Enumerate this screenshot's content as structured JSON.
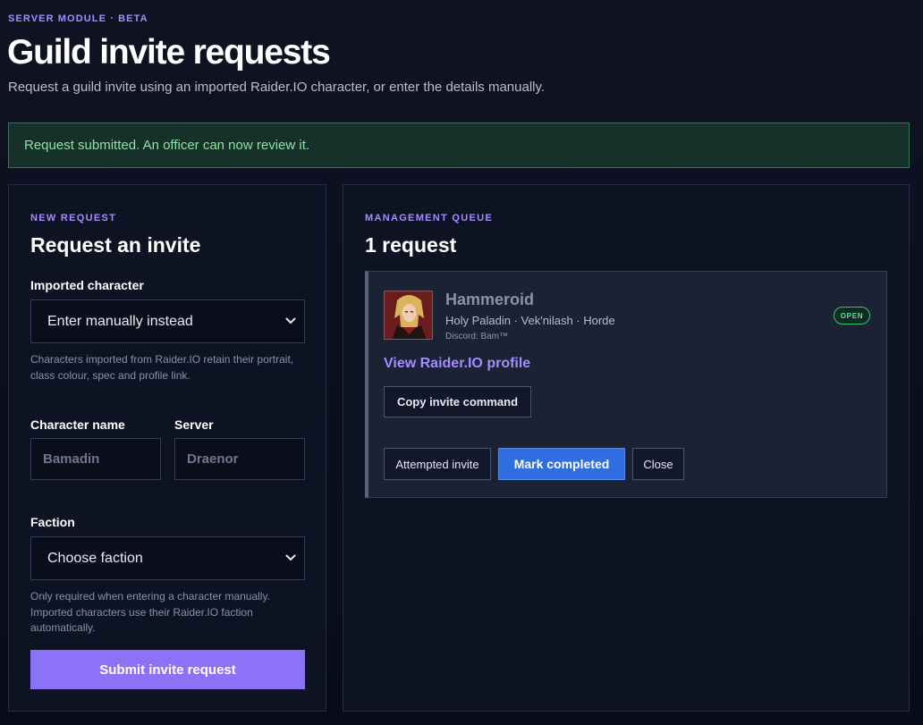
{
  "header": {
    "eyebrow": "SERVER MODULE · BETA",
    "title": "Guild invite requests",
    "subtitle": "Request a guild invite using an imported Raider.IO character, or enter the details manually."
  },
  "alert": {
    "text": "Request submitted. An officer can now review it.",
    "color": "#2f7a4f"
  },
  "request_form": {
    "eyebrow": "NEW REQUEST",
    "title": "Request an invite",
    "imported_label": "Imported character",
    "imported_value": "Enter manually instead",
    "imported_hint": "Characters imported from Raider.IO retain their portrait, class colour, spec and profile link.",
    "name_label": "Character name",
    "name_placeholder": "Bamadin",
    "server_label": "Server",
    "server_placeholder": "Draenor",
    "faction_label": "Faction",
    "faction_value": "Choose faction",
    "faction_hint": "Only required when entering a character manually. Imported characters use their Raider.IO faction automatically.",
    "submit_label": "Submit invite request",
    "accent": "#8b72f7"
  },
  "queue": {
    "eyebrow": "MANAGEMENT QUEUE",
    "title": "1 request",
    "requests": [
      {
        "name": "Hammeroid",
        "meta": "Holy Paladin · Vek'nilash · Horde",
        "discord": "Discord: Bam™",
        "status": "OPEN",
        "profile_link": "View Raider.IO profile",
        "copy_label": "Copy invite command",
        "actions": {
          "attempted": "Attempted invite",
          "completed": "Mark completed",
          "close": "Close"
        },
        "portrait_icon": "character-portrait"
      }
    ]
  }
}
